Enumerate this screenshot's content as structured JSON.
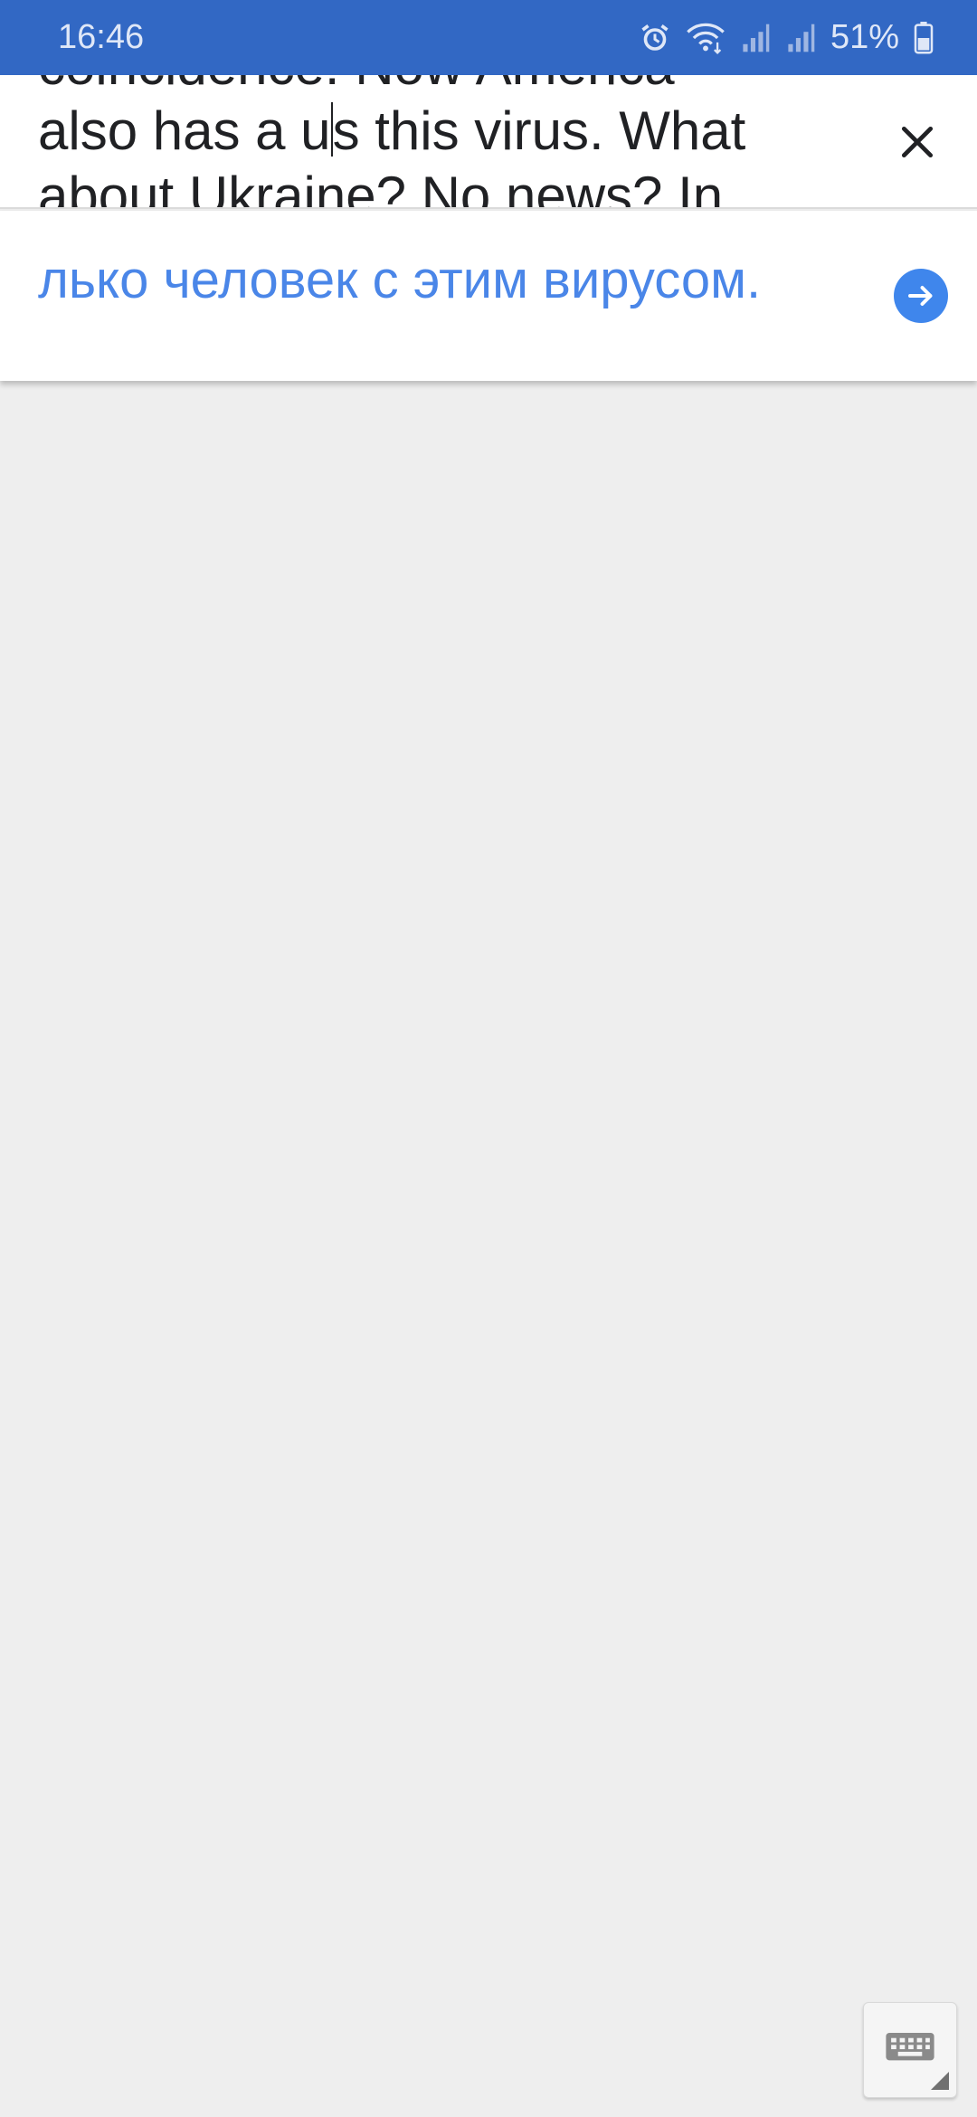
{
  "status_bar": {
    "time": "16:46",
    "battery_percent": "51%",
    "icons": [
      "alarm-icon",
      "wifi-icon",
      "signal-icon",
      "signal-icon",
      "battery-icon"
    ]
  },
  "input": {
    "line1": "coincidence.  Now America",
    "line2_before_caret": "also has a u",
    "line2_after_caret": "s this virus.  What",
    "line3": "about Ukraine?  No news?  In"
  },
  "translation": {
    "text": "лько человек с этим вирусом."
  },
  "colors": {
    "status_bar": "#3268c4",
    "accent": "#4a86e8",
    "background": "#eeeeee"
  }
}
